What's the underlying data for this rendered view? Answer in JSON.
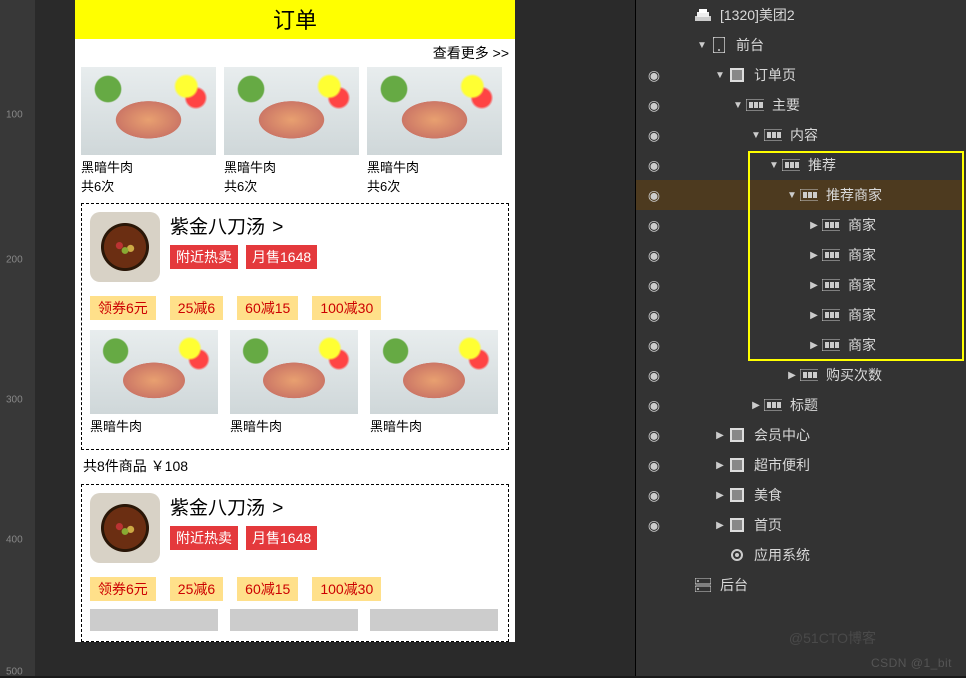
{
  "ruler": {
    "m100": "100",
    "m200": "200",
    "m300": "300",
    "m400": "400",
    "m500": "500"
  },
  "phone": {
    "title": "订单",
    "more": "查看更多 >>",
    "thumbs": [
      {
        "name": "黑暗牛肉",
        "times": "共6次"
      },
      {
        "name": "黑暗牛肉",
        "times": "共6次"
      },
      {
        "name": "黑暗牛肉",
        "times": "共6次"
      }
    ],
    "shop": {
      "name": "紫金八刀汤",
      "arrow": ">",
      "badge1": "附近热卖",
      "badge2": "月售1648",
      "coupons": [
        "领券6元",
        "25减6",
        "60减15",
        "100减30"
      ]
    },
    "thumbs2": [
      {
        "name": "黑暗牛肉"
      },
      {
        "name": "黑暗牛肉"
      },
      {
        "name": "黑暗牛肉"
      }
    ],
    "cart": "共8件商品 ￥108",
    "shop2": {
      "name": "紫金八刀汤",
      "arrow": ">",
      "badge1": "附近热卖",
      "badge2": "月售1648",
      "coupons": [
        "领券6元",
        "25减6",
        "60减15",
        "100减30"
      ]
    }
  },
  "tree": {
    "root": "[1320]美团2",
    "front": "前台",
    "order": "订单页",
    "main": "主要",
    "content": "内容",
    "recommend": "推荐",
    "recommend_shops": "推荐商家",
    "shop": "商家",
    "buy_count": "购买次数",
    "title_node": "标题",
    "member": "会员中心",
    "market": "超市便利",
    "food": "美食",
    "home": "首页",
    "app_sys": "应用系统",
    "backend": "后台"
  },
  "wm1": "@51CTO博客",
  "wm2": "CSDN @1_bit"
}
